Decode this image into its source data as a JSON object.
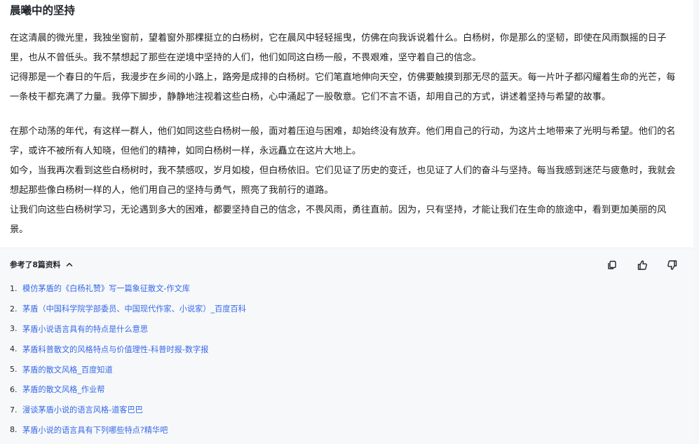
{
  "article": {
    "title": "晨曦中的坚持",
    "paragraphs": [
      "在这清晨的微光里，我独坐窗前，望着窗外那棵挺立的白杨树，它在晨风中轻轻摇曳，仿佛在向我诉说着什么。白杨树，你是那么的坚韧，即使在风雨飘摇的日子里，也从不曾低头。我不禁想起了那些在逆境中坚持的人们，他们如同这白杨一般，不畏艰难，坚守着自己的信念。",
      "记得那是一个春日的午后，我漫步在乡间的小路上，路旁是成排的白杨树。它们笔直地伸向天空，仿佛要触摸到那无尽的蓝天。每一片叶子都闪耀着生命的光芒，每一条枝干都充满了力量。我停下脚步，静静地注视着这些白杨，心中涌起了一股敬意。它们不言不语，却用自己的方式，讲述着坚持与希望的故事。",
      "在那个动荡的年代，有这样一群人，他们如同这些白杨树一般，面对着压迫与困难，却始终没有放弃。他们用自己的行动，为这片土地带来了光明与希望。他们的名字，或许不被所有人知晓，但他们的精神，如同白杨树一样，永远矗立在这片大地上。",
      "如今，当我再次看到这些白杨树时，我不禁感叹，岁月如梭，但白杨依旧。它们见证了历史的变迁，也见证了人们的奋斗与坚持。每当我感到迷茫与疲惫时，我就会想起那些像白杨树一样的人，他们用自己的坚持与勇气，照亮了我前行的道路。",
      "让我们向这些白杨树学习，无论遇到多大的困难，都要坚持自己的信念，不畏风雨，勇往直前。因为，只有坚持，才能让我们在生命的旅途中，看到更加美丽的风景。"
    ]
  },
  "references": {
    "toggle_label": "参考了8篇资料",
    "toggle_icon": "chevron-up-icon",
    "items": [
      {
        "num": "1.",
        "title": "模仿茅盾的《白杨礼赞》写一篇象征散文-作文库"
      },
      {
        "num": "2.",
        "title": "茅盾（中国科学院学部委员、中国现代作家、小说家）_百度百科"
      },
      {
        "num": "3.",
        "title": "茅盾小说语言具有的特点是什么意思"
      },
      {
        "num": "4.",
        "title": "茅盾科普散文的风格特点与价值理性-科普时报-数字报"
      },
      {
        "num": "5.",
        "title": "茅盾的散文风格_百度知道"
      },
      {
        "num": "6.",
        "title": "茅盾的散文风格_作业帮"
      },
      {
        "num": "7.",
        "title": "漫谈茅盾小说的语言风格-道客巴巴"
      },
      {
        "num": "8.",
        "title": "茅盾小说的语言具有下列哪些特点?精华吧"
      }
    ]
  },
  "actions": {
    "icons": [
      "copy-icon",
      "thumbs-up-icon",
      "thumbs-down-icon"
    ]
  },
  "colors": {
    "link": "#3569e8",
    "text": "#202124",
    "panel_bg": "#f7f8fa"
  }
}
